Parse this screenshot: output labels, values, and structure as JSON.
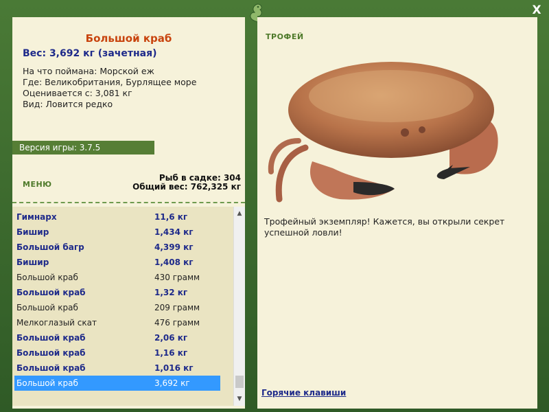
{
  "window": {
    "close_label": "X"
  },
  "fish": {
    "title": "Большой краб",
    "weight_line": "Вес: 3,692 кг (зачетная)",
    "bait": "На что поймана: Морской еж",
    "location": "Где: Великобритания, Бурлящее море",
    "rated_from": "Оценивается с: 3,081 кг",
    "kind": "Вид: Ловится редко"
  },
  "game": {
    "version": "Версия игры: 3.7.5"
  },
  "menu": {
    "label": "МЕНЮ"
  },
  "stats": {
    "fish_in_keepnet": "Рыб в садке: 304",
    "total_weight": "Общий вес: 762,325 кг"
  },
  "catch_list": [
    {
      "name": "Гимнарх",
      "weight": "11,6 кг",
      "style": "trophy"
    },
    {
      "name": "Бишир",
      "weight": "1,434 кг",
      "style": "trophy"
    },
    {
      "name": "Большой багр",
      "weight": "4,399 кг",
      "style": "trophy"
    },
    {
      "name": "Бишир",
      "weight": "1,408 кг",
      "style": "trophy"
    },
    {
      "name": "Большой краб",
      "weight": "430 грамм",
      "style": "normal"
    },
    {
      "name": "Большой краб",
      "weight": "1,32 кг",
      "style": "trophy"
    },
    {
      "name": "Большой краб",
      "weight": "209 грамм",
      "style": "normal"
    },
    {
      "name": "Мелкоглазый скат",
      "weight": "476 грамм",
      "style": "normal"
    },
    {
      "name": "Большой краб",
      "weight": "2,06 кг",
      "style": "trophy"
    },
    {
      "name": "Большой краб",
      "weight": "1,16 кг",
      "style": "trophy"
    },
    {
      "name": "Большой краб",
      "weight": "1,016 кг",
      "style": "trophy"
    },
    {
      "name": "Большой краб",
      "weight": "3,692 кг",
      "style": "selected"
    }
  ],
  "trophy": {
    "label": "ТРОФЕЙ",
    "text": "Трофейный экземпляр! Кажется, вы открыли секрет успешной ловли!"
  },
  "links": {
    "hotkeys": "Горячие клавиши"
  },
  "colors": {
    "frame": "#35612a",
    "panel": "#f6f2da",
    "accent_green": "#567e35",
    "title_orange": "#c8440e",
    "trophy_blue": "#1e2a8a",
    "selection": "#3399ff"
  }
}
